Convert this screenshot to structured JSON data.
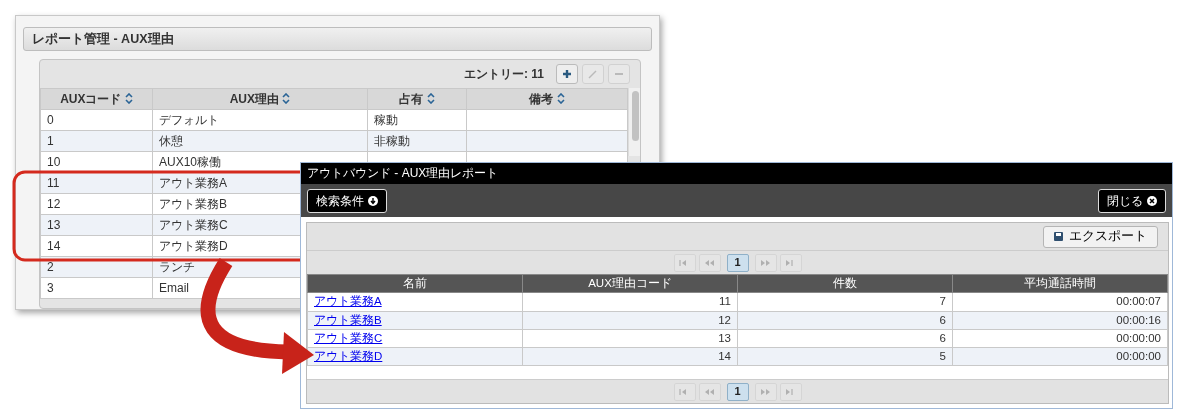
{
  "report_window": {
    "title": "レポート管理 - AUX理由",
    "entry_count": "エントリー: 11",
    "toolbar_buttons": [
      {
        "kind": "add",
        "disabled": false
      },
      {
        "kind": "edit",
        "disabled": true
      },
      {
        "kind": "delete",
        "disabled": true
      }
    ],
    "table": {
      "columns": [
        "AUXコード",
        "AUX理由",
        "占有",
        "備考"
      ],
      "rows": [
        {
          "code": "0",
          "reason": "デフォルト",
          "occupancy": "稼動"
        },
        {
          "code": "1",
          "reason": "休憩",
          "occupancy": "非稼動"
        },
        {
          "code": "10",
          "reason": "AUX10稼働"
        },
        {
          "code": "11",
          "reason": "アウト業務A"
        },
        {
          "code": "12",
          "reason": "アウト業務B"
        },
        {
          "code": "13",
          "reason": "アウト業務C"
        },
        {
          "code": "14",
          "reason": "アウト業務D"
        },
        {
          "code": "2",
          "reason": "ランチ"
        },
        {
          "code": "3",
          "reason": "Email"
        }
      ]
    }
  },
  "outbound_window": {
    "title": "アウトバウンド - AUX理由レポート",
    "search_button": "検索条件",
    "close_button": "閉じる",
    "export_button": "エクスポート",
    "pager_top": [
      {
        "kind": "first",
        "disabled": true
      },
      {
        "kind": "prev",
        "disabled": true
      },
      {
        "kind": "page",
        "label": "1",
        "selected": true
      },
      {
        "kind": "next",
        "disabled": true
      },
      {
        "kind": "last",
        "disabled": true
      }
    ],
    "table": {
      "columns": [
        "名前",
        "AUX理由コード",
        "件数",
        "平均通話時間"
      ],
      "rows": [
        {
          "name": "アウト業務A",
          "code": "11",
          "count": "7",
          "avg_time": "00:00:07"
        },
        {
          "name": "アウト業務B",
          "code": "12",
          "count": "6",
          "avg_time": "00:00:16"
        },
        {
          "name": "アウト業務C",
          "code": "13",
          "count": "6",
          "avg_time": "00:00:00"
        },
        {
          "name": "アウト業務D",
          "code": "14",
          "count": "5",
          "avg_time": "00:00:00"
        }
      ]
    },
    "pager_bottom": [
      {
        "kind": "first",
        "disabled": true
      },
      {
        "kind": "prev",
        "disabled": true
      },
      {
        "kind": "page",
        "label": "1",
        "selected": true
      },
      {
        "kind": "next",
        "disabled": true
      },
      {
        "kind": "last",
        "disabled": true
      }
    ]
  }
}
